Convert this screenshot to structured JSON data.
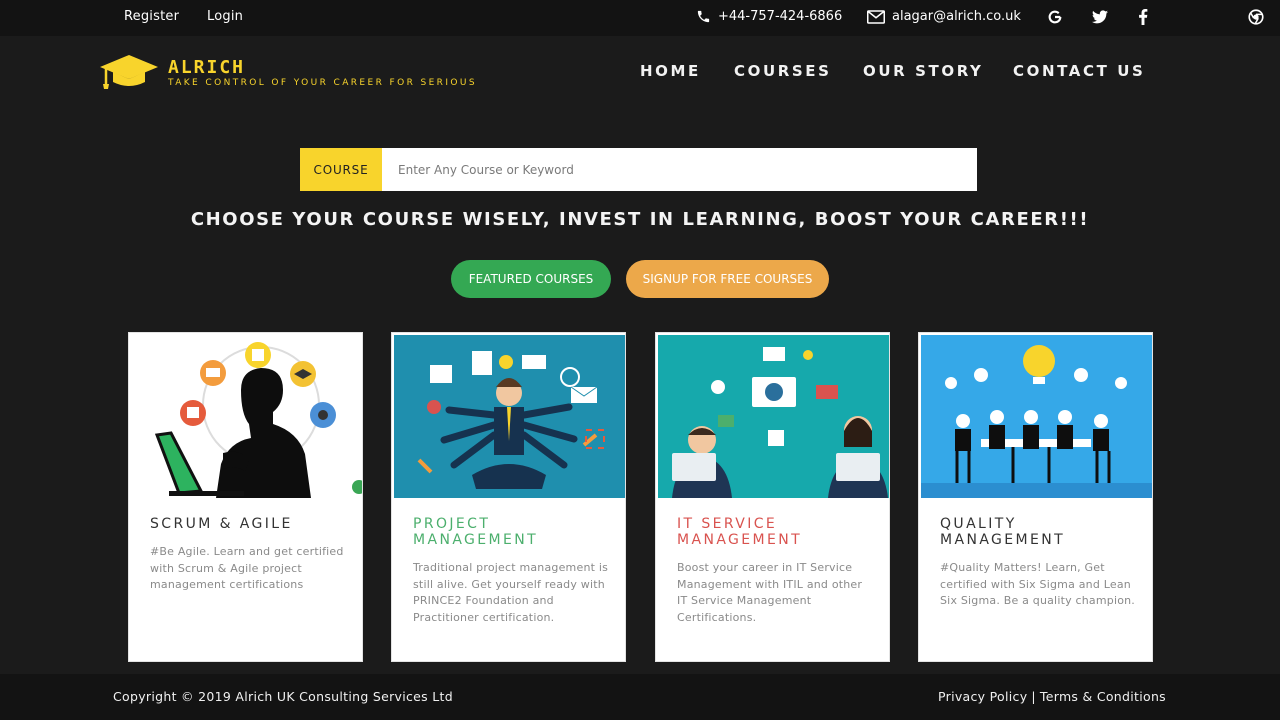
{
  "topbar": {
    "register": "Register",
    "login": "Login",
    "phone": "+44-757-424-6866",
    "email": "alagar@alrich.co.uk",
    "icons": [
      "phone-icon",
      "mail-icon",
      "google-icon",
      "twitter-icon",
      "facebook-icon",
      "chrome-extension-icon"
    ]
  },
  "header": {
    "brand": "ALRICH",
    "tagline": "TAKE CONTROL OF YOUR CAREER FOR SERIOUS",
    "nav": [
      "HOME",
      "COURSES",
      "OUR STORY",
      "CONTACT US"
    ]
  },
  "search": {
    "tag": "COURSE",
    "placeholder": "Enter Any Course or Keyword"
  },
  "hero": {
    "headline": "CHOOSE YOUR COURSE WISELY, INVEST IN LEARNING, BOOST YOUR CAREER!!!",
    "primary_button": "FEATURED COURSES",
    "secondary_button": "SIGNUP FOR FREE COURSES"
  },
  "cards": [
    {
      "title": "SCRUM & AGILE",
      "desc": "#Be Agile. Learn and get certified with Scrum & Agile project management certifications",
      "color": "#333333"
    },
    {
      "title": "PROJECT MANAGEMENT",
      "desc": "Traditional project management is still alive. Get yourself ready with PRINCE2 Foundation and Practitioner certification.",
      "color": "#4caf6d"
    },
    {
      "title": "IT SERVICE MANAGEMENT",
      "desc": "Boost your career in IT Service Management with ITIL and other IT Service Management Certifications.",
      "color": "#d9534f"
    },
    {
      "title": "QUALITY MANAGEMENT",
      "desc": "#Quality Matters! Learn, Get certified with Six Sigma and Lean Six Sigma. Be a quality champion.",
      "color": "#333333"
    }
  ],
  "footer": {
    "copyright": "Copyright © 2019 Alrich UK Consulting Services Ltd",
    "privacy": "Privacy Policy",
    "separator": "|",
    "terms": "Terms & Conditions"
  },
  "colors": {
    "brand_yellow": "#f8d42c",
    "dark_bg": "#1b1b1b",
    "green": "#34a853",
    "orange": "#eca84a"
  }
}
